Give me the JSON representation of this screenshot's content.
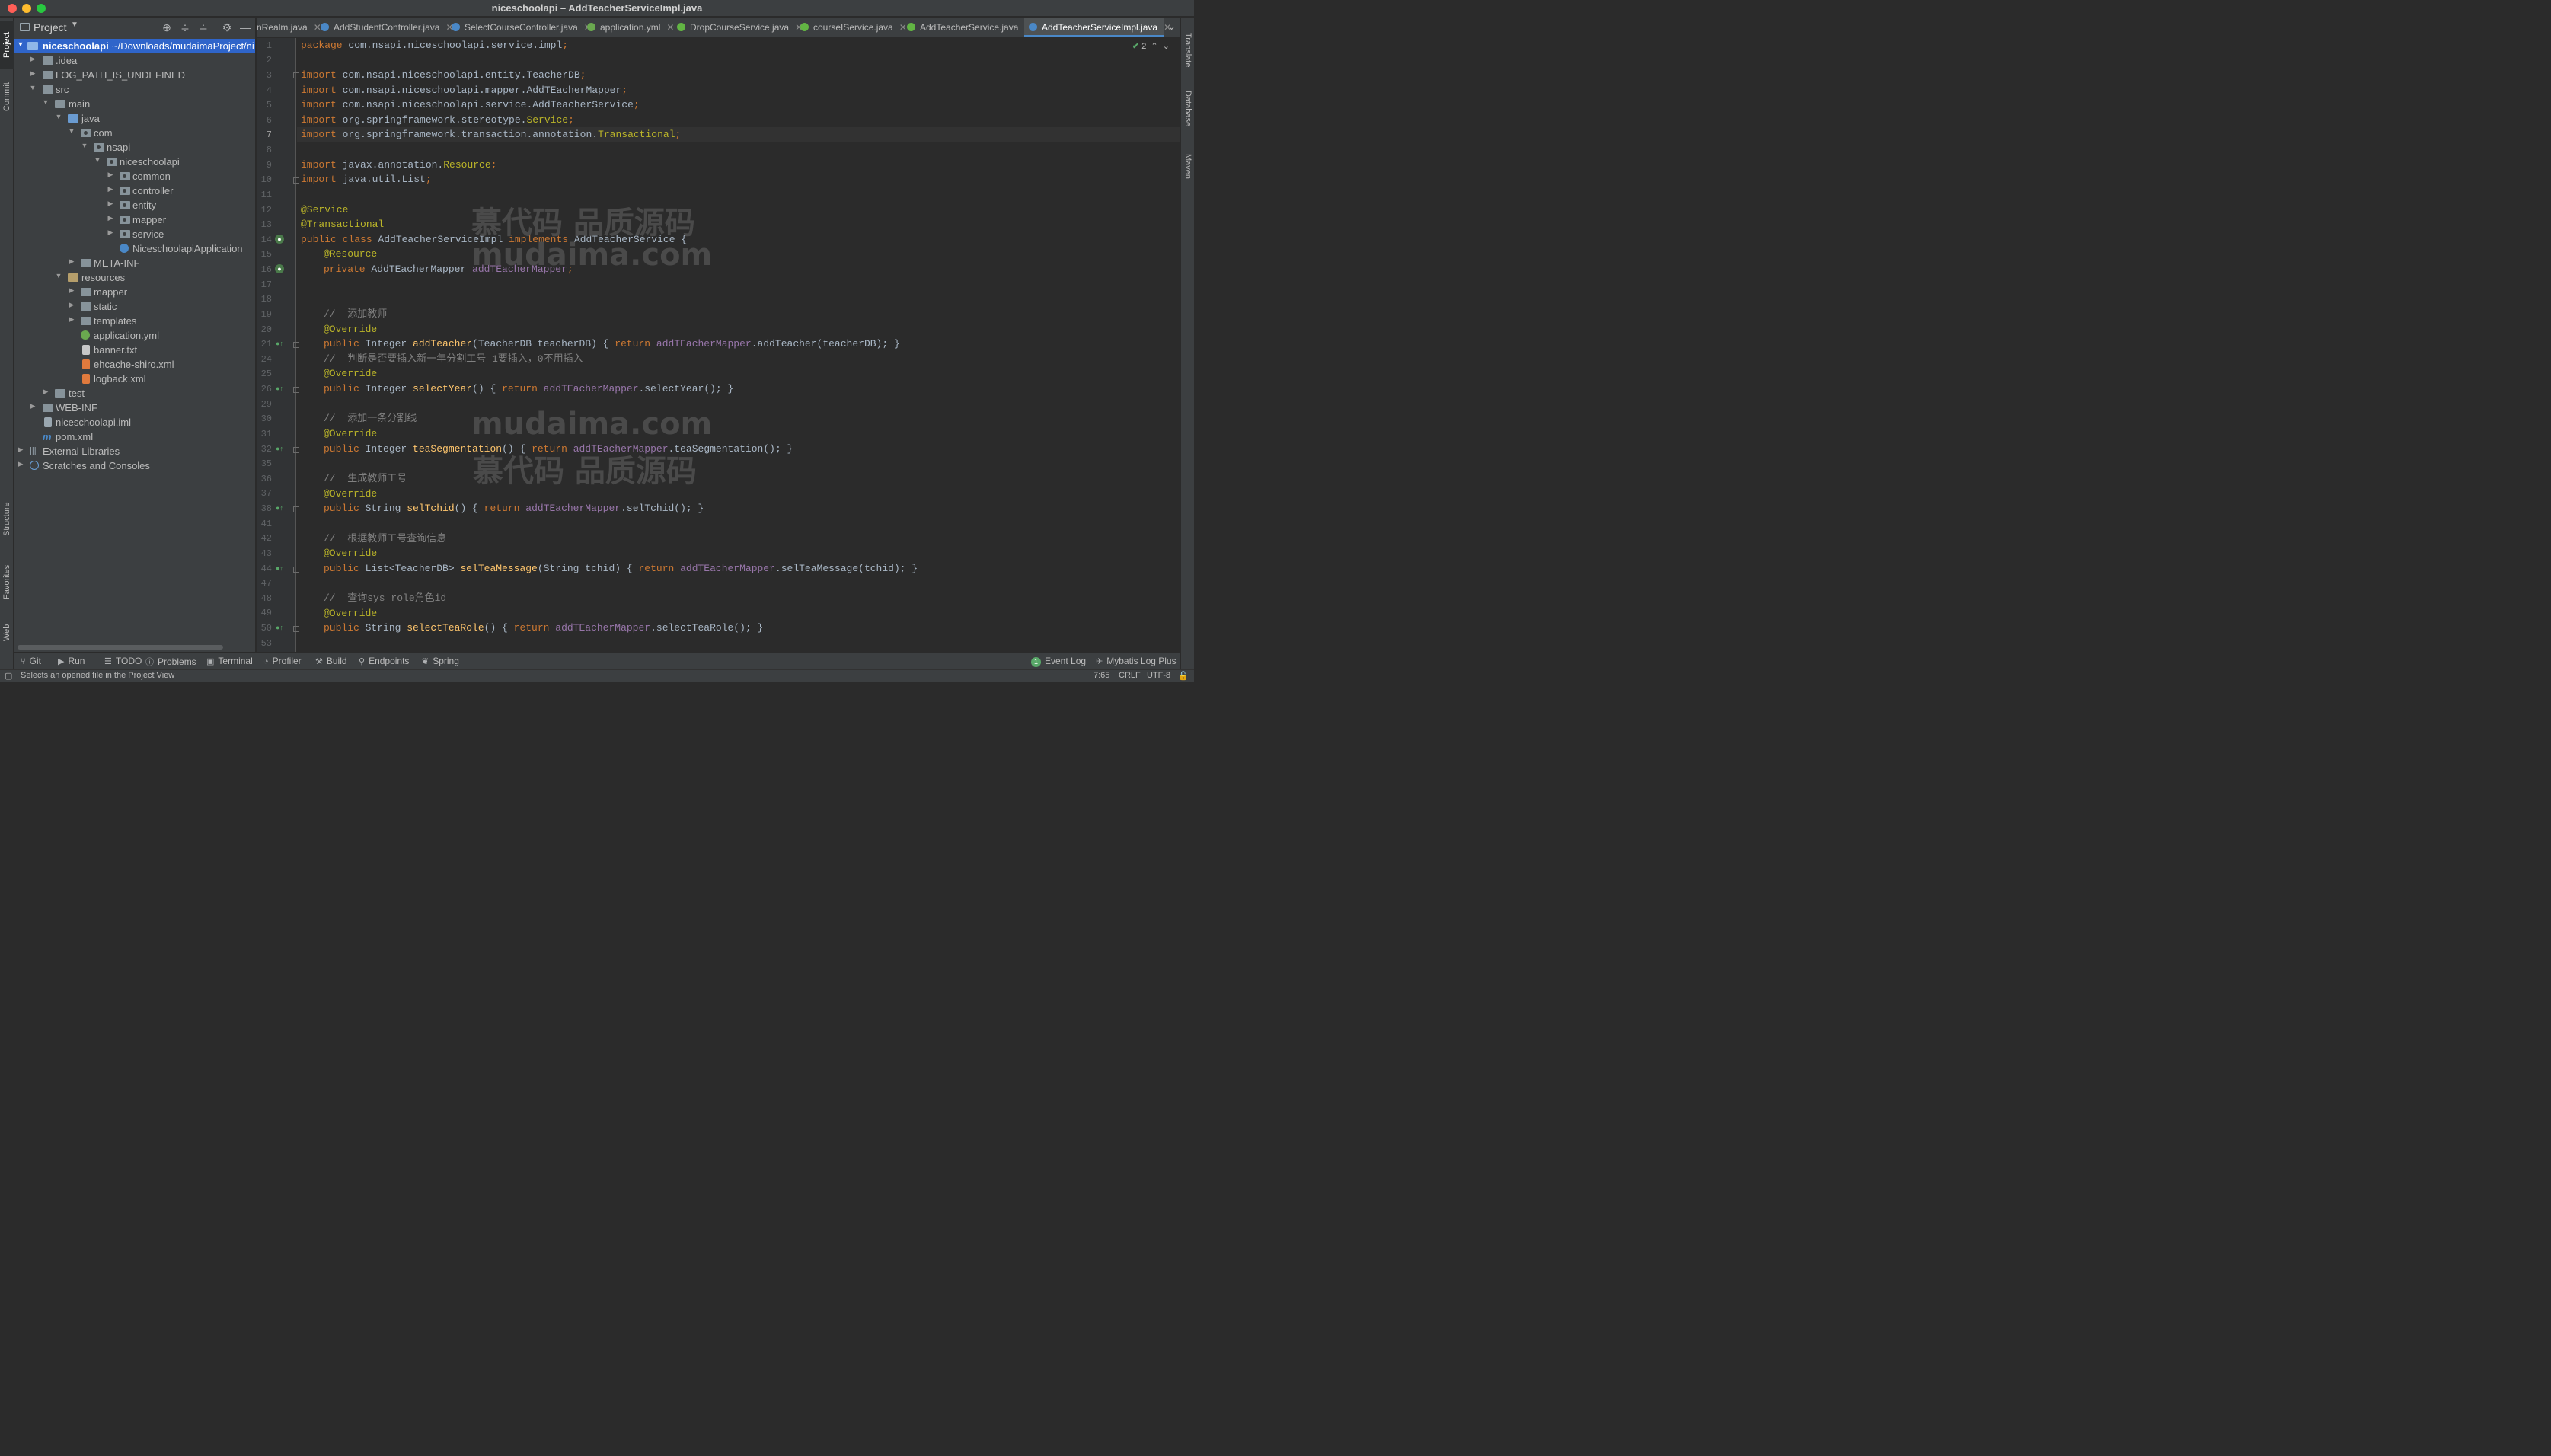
{
  "window": {
    "title": "niceschoolapi – AddTeacherServiceImpl.java"
  },
  "left_strip": {
    "project": "Project",
    "commit": "Commit",
    "structure": "Structure",
    "favorites": "Favorites",
    "web": "Web"
  },
  "right_strip": {
    "translate": "Translate",
    "database": "Database",
    "maven": "Maven"
  },
  "project_panel": {
    "title": "Project",
    "root_name": "niceschoolapi",
    "root_path": "~/Downloads/mudaimaProject/ni",
    "tree": [
      {
        "label": ".idea"
      },
      {
        "label": "LOG_PATH_IS_UNDEFINED"
      },
      {
        "label": "src"
      },
      {
        "label": "main"
      },
      {
        "label": "java"
      },
      {
        "label": "com"
      },
      {
        "label": "nsapi"
      },
      {
        "label": "niceschoolapi"
      },
      {
        "label": "common"
      },
      {
        "label": "controller"
      },
      {
        "label": "entity"
      },
      {
        "label": "mapper"
      },
      {
        "label": "service"
      },
      {
        "label": "NiceschoolapiApplication"
      },
      {
        "label": "META-INF"
      },
      {
        "label": "resources"
      },
      {
        "label": "mapper"
      },
      {
        "label": "static"
      },
      {
        "label": "templates"
      },
      {
        "label": "application.yml"
      },
      {
        "label": "banner.txt"
      },
      {
        "label": "ehcache-shiro.xml"
      },
      {
        "label": "logback.xml"
      },
      {
        "label": "test"
      },
      {
        "label": "WEB-INF"
      },
      {
        "label": "niceschoolapi.iml"
      },
      {
        "label": "pom.xml"
      },
      {
        "label": "External Libraries"
      },
      {
        "label": "Scratches and Consoles"
      }
    ]
  },
  "tabs": [
    {
      "label": "nRealm.java",
      "icon": "class-icon",
      "color": "#4a88c7"
    },
    {
      "label": "AddStudentController.java",
      "icon": "class-icon",
      "color": "#4a88c7"
    },
    {
      "label": "SelectCourseController.java",
      "icon": "class-icon",
      "color": "#4a88c7"
    },
    {
      "label": "application.yml",
      "icon": "spring-icon",
      "color": "#6aa84f"
    },
    {
      "label": "DropCourseService.java",
      "icon": "interface-icon",
      "color": "#62b543"
    },
    {
      "label": "courseIService.java",
      "icon": "interface-icon",
      "color": "#62b543"
    },
    {
      "label": "AddTeacherService.java",
      "icon": "interface-icon",
      "color": "#62b543"
    },
    {
      "label": "AddTeacherServiceImpl.java",
      "icon": "class-icon",
      "color": "#4a88c7",
      "active": true
    }
  ],
  "editor": {
    "inspection_count": "2",
    "current_line": "7",
    "line_numbers": [
      "1",
      "2",
      "3",
      "4",
      "5",
      "6",
      "7",
      "8",
      "9",
      "10",
      "11",
      "12",
      "13",
      "14",
      "15",
      "16",
      "17",
      "18",
      "19",
      "20",
      "21",
      "24",
      "25",
      "26",
      "29",
      "30",
      "31",
      "32",
      "35",
      "36",
      "37",
      "38",
      "41",
      "42",
      "43",
      "44",
      "47",
      "48",
      "49",
      "50",
      "53"
    ],
    "code": {
      "l1": {
        "a": "package ",
        "b": "com.nsapi.niceschoolapi.service.impl",
        "c": ";"
      },
      "l3": {
        "a": "import ",
        "b": "com.nsapi.niceschoolapi.entity.TeacherDB",
        "c": ";"
      },
      "l4": {
        "a": "import ",
        "b": "com.nsapi.niceschoolapi.mapper.AddTEacherMapper",
        "c": ";"
      },
      "l5": {
        "a": "import ",
        "b": "com.nsapi.niceschoolapi.service.AddTeacherService",
        "c": ";"
      },
      "l6": {
        "a": "import ",
        "b": "org.springframework.stereotype.",
        "t": "Service",
        "c": ";"
      },
      "l7": {
        "a": "import ",
        "b": "org.springframework.transaction.annotation.",
        "t": "Transactional",
        "c": ";"
      },
      "l9": {
        "a": "import ",
        "b": "javax.annotation.",
        "t": "Resource",
        "c": ";"
      },
      "l10": {
        "a": "import ",
        "b": "java.util.List",
        "c": ";"
      },
      "l12": "@Service",
      "l13": "@Transactional",
      "l14": {
        "a": "public class ",
        "b": "AddTeacherServiceImpl ",
        "c": "implements ",
        "d": "AddTeacherService {"
      },
      "l15": "@Resource",
      "l16": {
        "a": "private ",
        "b": "AddTEacherMapper ",
        "c": "addTEacherMapper",
        "d": ";"
      },
      "l19": "//  添加教师",
      "l20": "@Override",
      "l21": {
        "a": "public ",
        "b": "Integer ",
        "f": "addTeacher",
        "c": "(TeacherDB teacherDB) { ",
        "r": "return ",
        "m": "addTEacherMapper",
        "d": ".addTeacher(teacherDB); }"
      },
      "l24": "//  判断是否要插入新一年分割工号 1要插入，0不用插入",
      "l25": "@Override",
      "l26": {
        "a": "public ",
        "b": "Integer ",
        "f": "selectYear",
        "c": "() { ",
        "r": "return ",
        "m": "addTEacherMapper",
        "d": ".selectYear(); }"
      },
      "l30": "//  添加一条分割线",
      "l31": "@Override",
      "l32": {
        "a": "public ",
        "b": "Integer ",
        "f": "teaSegmentation",
        "c": "() { ",
        "r": "return ",
        "m": "addTEacherMapper",
        "d": ".teaSegmentation(); }"
      },
      "l36": "//  生成教师工号",
      "l37": "@Override",
      "l38": {
        "a": "public ",
        "b": "String ",
        "f": "selTchid",
        "c": "() { ",
        "r": "return ",
        "m": "addTEacherMapper",
        "d": ".selTchid(); }"
      },
      "l42": "//  根据教师工号查询信息",
      "l43": "@Override",
      "l44": {
        "a": "public ",
        "b": "List<TeacherDB> ",
        "f": "selTeaMessage",
        "c": "(String tchid) { ",
        "r": "return ",
        "m": "addTEacherMapper",
        "d": ".selTeaMessage(tchid); }"
      },
      "l48": "//  查询sys_role角色id",
      "l49": "@Override",
      "l50": {
        "a": "public ",
        "b": "String ",
        "f": "selectTeaRole",
        "c": "() { ",
        "r": "return ",
        "m": "addTEacherMapper",
        "d": ".selectTeaRole(); }"
      }
    },
    "watermarks": [
      "慕代码 品质源码",
      "mudaima.com",
      "mudaima.com",
      "慕代码 品质源码"
    ]
  },
  "bottom_tools": {
    "git": "Git",
    "run": "Run",
    "todo": "TODO",
    "problems": "Problems",
    "terminal": "Terminal",
    "profiler": "Profiler",
    "build": "Build",
    "endpoints": "Endpoints",
    "spring": "Spring",
    "event_log": "Event Log",
    "event_log_count": "1",
    "mybatis": "Mybatis Log Plus"
  },
  "status": {
    "message": "Selects an opened file in the Project View",
    "position": "7:65",
    "line_sep": "CRLF",
    "encoding": "UTF-8"
  },
  "colors": {
    "accent": "#2f65ca",
    "keyword": "#cc7832",
    "annotation": "#bbb529",
    "method": "#ffc66d",
    "field": "#9876aa",
    "comment": "#808080"
  }
}
